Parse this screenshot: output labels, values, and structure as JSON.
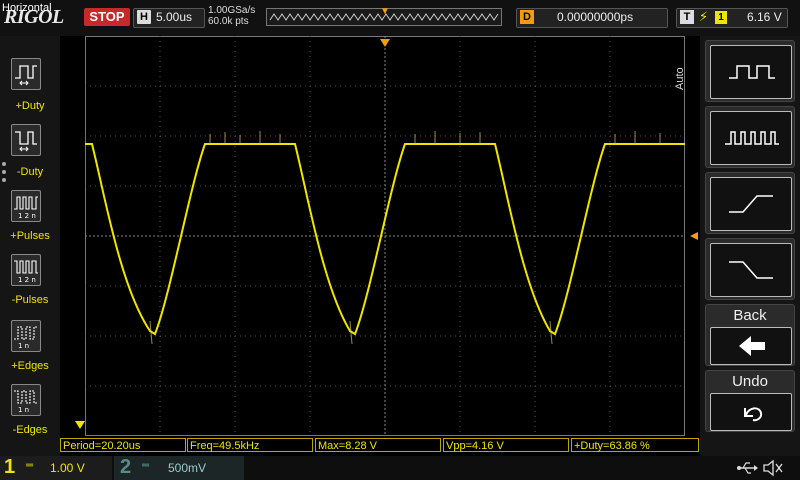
{
  "top": {
    "brand": "RIGOL",
    "run_state": "STOP",
    "horizontal_label": "H",
    "timebase": "5.00us",
    "sample_rate": "1.00GSa/s",
    "memory_depth": "60.0k pts",
    "delay_label": "D",
    "delay_value": "0.00000000ps",
    "trigger_label": "T",
    "trigger_source": "1",
    "trigger_level": "6.16 V"
  },
  "left_panel": {
    "title": "Horizontal",
    "items": [
      {
        "label": "+Duty",
        "icon": "positive-duty-icon"
      },
      {
        "label": "-Duty",
        "icon": "negative-duty-icon"
      },
      {
        "label": "+Pulses",
        "icon": "positive-pulses-icon"
      },
      {
        "label": "-Pulses",
        "icon": "negative-pulses-icon"
      },
      {
        "label": "+Edges",
        "icon": "positive-edges-icon"
      },
      {
        "label": "-Edges",
        "icon": "negative-edges-icon"
      }
    ]
  },
  "right_panel": {
    "mode_label": "Auto",
    "buttons": [
      {
        "name": "pulse-wide-icon"
      },
      {
        "name": "pulse-narrow-icon"
      },
      {
        "name": "rising-ramp-icon"
      },
      {
        "name": "falling-ramp-icon"
      },
      {
        "caption": "Back",
        "icon": "back-arrow-icon"
      },
      {
        "caption": "Undo",
        "icon": "undo-icon"
      }
    ]
  },
  "measurements": [
    {
      "text": "Period=20.20us"
    },
    {
      "text": "Freq=49.5kHz"
    },
    {
      "text": "Max=8.28 V"
    },
    {
      "text": "Vpp=4.16 V"
    },
    {
      "text": "+Duty=63.86 %"
    }
  ],
  "channels": [
    {
      "number": "1",
      "scale": "1.00 V",
      "color": "#f1e400"
    },
    {
      "number": "2",
      "scale": "500mV",
      "color": "#5a8a8a"
    }
  ],
  "colors": {
    "trace": "#f1e400",
    "accent": "#f39c12",
    "stop": "#c42a2a"
  }
}
